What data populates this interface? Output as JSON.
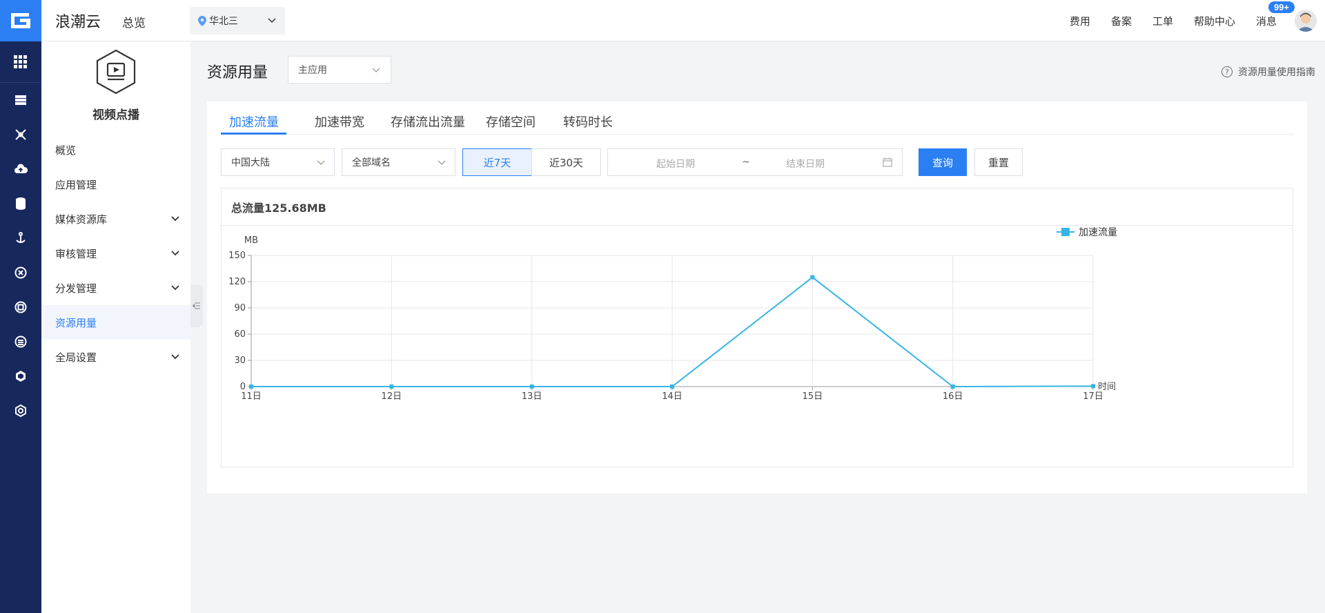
{
  "topbar": {
    "brand": "浪潮云",
    "overview": "总览",
    "region": "华北三",
    "nav": [
      "费用",
      "备案",
      "工单",
      "帮助中心",
      "消息"
    ],
    "badge": "99+"
  },
  "rail": {
    "icons": [
      "grid-icon",
      "server-icon",
      "network-icon",
      "cloud-upload-icon",
      "database-icon",
      "anchor-icon",
      "cross-icon",
      "media-icon",
      "layers-icon",
      "hexagon-icon",
      "play-hex-icon"
    ]
  },
  "sidebar": {
    "product_name": "视频点播",
    "items": [
      {
        "label": "概览",
        "expandable": false
      },
      {
        "label": "应用管理",
        "expandable": false
      },
      {
        "label": "媒体资源库",
        "expandable": true
      },
      {
        "label": "审核管理",
        "expandable": true
      },
      {
        "label": "分发管理",
        "expandable": true
      },
      {
        "label": "资源用量",
        "expandable": false,
        "active": true
      },
      {
        "label": "全局设置",
        "expandable": true
      }
    ]
  },
  "main": {
    "title": "资源用量",
    "app_select": "主应用",
    "guide": "资源用量使用指南",
    "tabs": [
      "加速流量",
      "加速带宽",
      "存储流出流量",
      "存储空间",
      "转码时长"
    ],
    "active_tab": "加速流量",
    "filters": {
      "region": "中国大陆",
      "domain": "全部域名",
      "range_options": [
        "近7天",
        "近30天"
      ],
      "active_range": "近7天",
      "start_placeholder": "起始日期",
      "separator": "~",
      "end_placeholder": "结束日期",
      "query": "查询",
      "reset": "重置"
    },
    "total_label": "总流量125.68MB"
  },
  "chart_data": {
    "type": "line",
    "x": [
      "11日",
      "12日",
      "13日",
      "14日",
      "15日",
      "16日",
      "17日"
    ],
    "series": [
      {
        "name": "加速流量",
        "values": [
          0,
          0,
          0,
          0,
          125,
          0,
          0.5
        ]
      }
    ],
    "xlabel": "时间",
    "ylabel": "MB",
    "ylim": [
      0,
      150
    ],
    "yticks": [
      0,
      30,
      60,
      90,
      120,
      150
    ],
    "grid": true,
    "legend": "top-right",
    "color": "#36b5e6"
  }
}
